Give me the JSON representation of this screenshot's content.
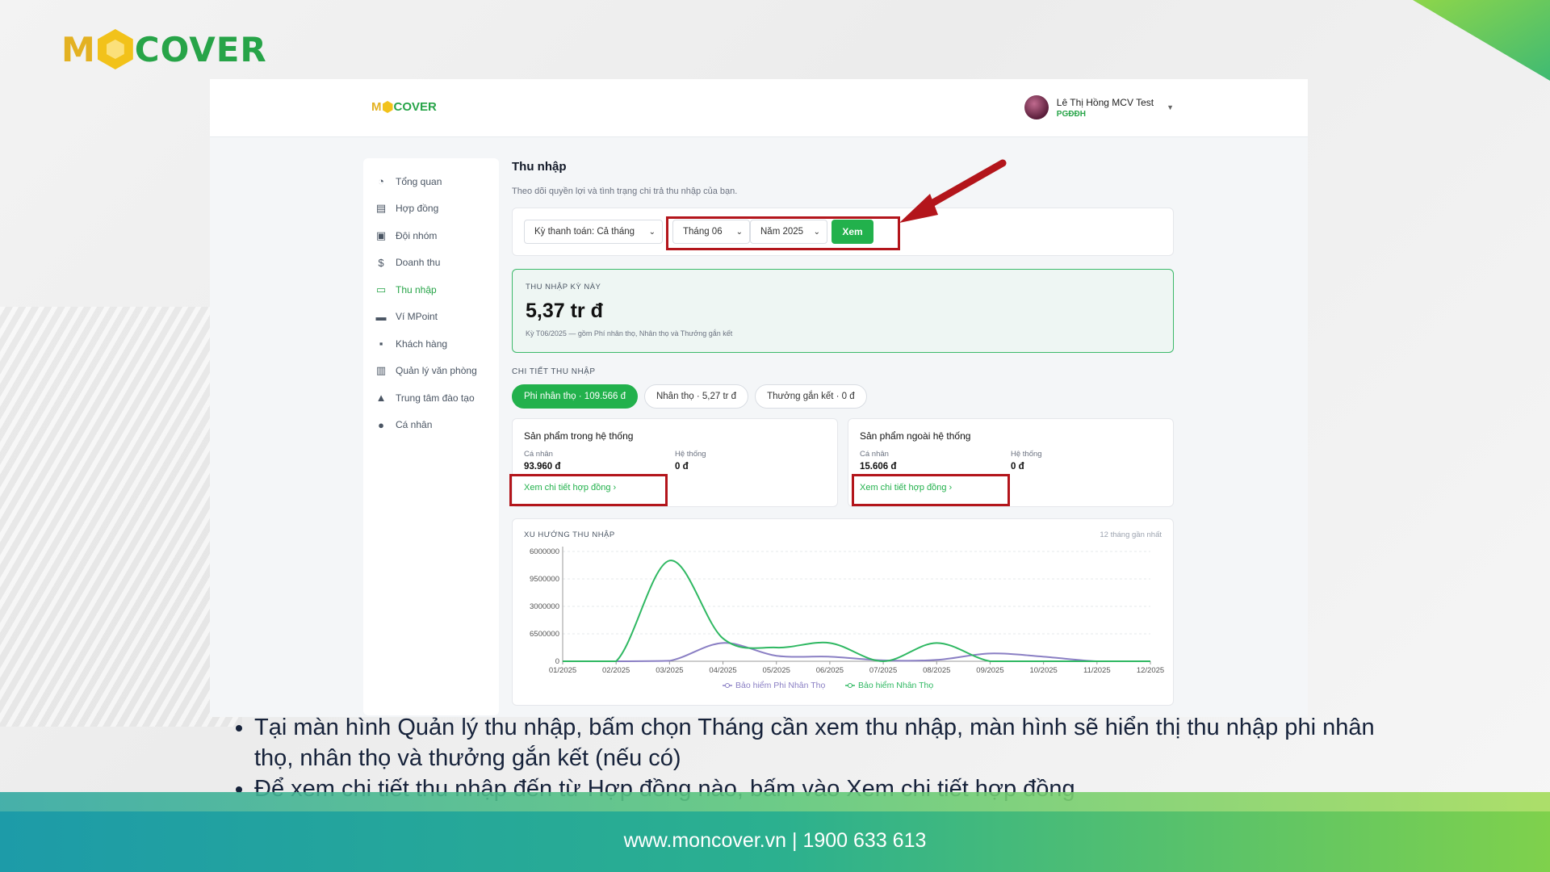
{
  "brand": {
    "logo_left": "M",
    "logo_right": "COVER"
  },
  "app": {
    "logo_left": "M",
    "logo_right": "COVER",
    "user": {
      "name": "Lê Thị Hồng MCV Test",
      "role": "PGĐĐH"
    }
  },
  "sidebar": {
    "items": [
      {
        "label": "Tổng quan",
        "icon": "dashboard-icon"
      },
      {
        "label": "Hợp đồng",
        "icon": "document-icon"
      },
      {
        "label": "Đội nhóm",
        "icon": "team-icon"
      },
      {
        "label": "Doanh thu",
        "icon": "dollar-icon"
      },
      {
        "label": "Thu nhập",
        "icon": "wallet-icon",
        "active": true
      },
      {
        "label": "Ví MPoint",
        "icon": "card-icon"
      },
      {
        "label": "Khách hàng",
        "icon": "contact-icon"
      },
      {
        "label": "Quản lý văn phòng",
        "icon": "building-icon"
      },
      {
        "label": "Trung tâm đào tạo",
        "icon": "graduation-icon"
      },
      {
        "label": "Cá nhân",
        "icon": "user-icon"
      }
    ]
  },
  "main": {
    "title": "Thu nhập",
    "subtitle": "Theo dõi quyền lợi và tình trạng chi trả thu nhập của bạn.",
    "filters": {
      "period": "Kỳ thanh toán: Cả tháng",
      "month": "Tháng 06",
      "year": "Năm 2025",
      "view_button": "Xem"
    },
    "income": {
      "label": "THU NHẬP KỲ NÀY",
      "value": "5,37 tr đ",
      "note": "Kỳ T06/2025 — gồm Phí nhân thọ, Nhân thọ và Thưởng gắn kết"
    },
    "detail_label": "CHI TIẾT THU NHẬP",
    "tabs": [
      {
        "label": "Phi nhân thọ · 109.566 đ",
        "active": true
      },
      {
        "label": "Nhân thọ · 5,27 tr đ"
      },
      {
        "label": "Thưởng gắn kết · 0 đ"
      }
    ],
    "products": [
      {
        "title": "Sản phẩm trong hệ thống",
        "personal_label": "Cá nhân",
        "personal_value": "93.960 đ",
        "system_label": "Hệ thống",
        "system_value": "0 đ",
        "link": "Xem chi tiết hợp đồng ›"
      },
      {
        "title": "Sản phẩm ngoài hệ thống",
        "personal_label": "Cá nhân",
        "personal_value": "15.606 đ",
        "system_label": "Hệ thống",
        "system_value": "0 đ",
        "link": "Xem chi tiết hợp đồng ›"
      }
    ],
    "trend_label": "XU HƯỚNG THU NHẬP",
    "trend_range": "12 tháng gần nhất"
  },
  "chart_data": {
    "type": "line",
    "title": "XU HƯỚNG THU NHẬP",
    "x": [
      "01/2025",
      "02/2025",
      "03/2025",
      "04/2025",
      "05/2025",
      "06/2025",
      "07/2025",
      "08/2025",
      "09/2025",
      "10/2025",
      "11/2025",
      "12/2025"
    ],
    "y_ticks": [
      "0",
      "6500000",
      "3000000",
      "9500000",
      "6000000"
    ],
    "series": [
      {
        "name": "Bảo hiểm Phi Nhân Thọ",
        "color": "#8a7fc4",
        "values": [
          0,
          0,
          100000,
          4000000,
          1200000,
          1000000,
          200000,
          300000,
          1700000,
          1000000,
          0,
          0
        ]
      },
      {
        "name": "Bảo hiểm Nhân Thọ",
        "color": "#2fb862",
        "values": [
          0,
          0,
          22000000,
          5000000,
          3000000,
          4000000,
          0,
          4000000,
          0,
          0,
          0,
          0
        ]
      }
    ],
    "ylim": [
      0,
      24000000
    ],
    "grid": true,
    "legend": "bottom"
  },
  "bullets": [
    "Tại màn hình Quản lý thu nhập, bấm chọn Tháng cần xem thu nhập, màn hình sẽ hiển thị thu nhập phi nhân thọ, nhân thọ và thưởng gắn kết (nếu có)",
    "Để xem chi tiết thu nhập đến từ Hợp đồng nào, bấm vào Xem chi tiết hợp đồng"
  ],
  "footer": {
    "text": "www.moncover.vn | 1900 633 613"
  },
  "colors": {
    "accent": "#22b14c",
    "highlight": "#b3151b"
  }
}
